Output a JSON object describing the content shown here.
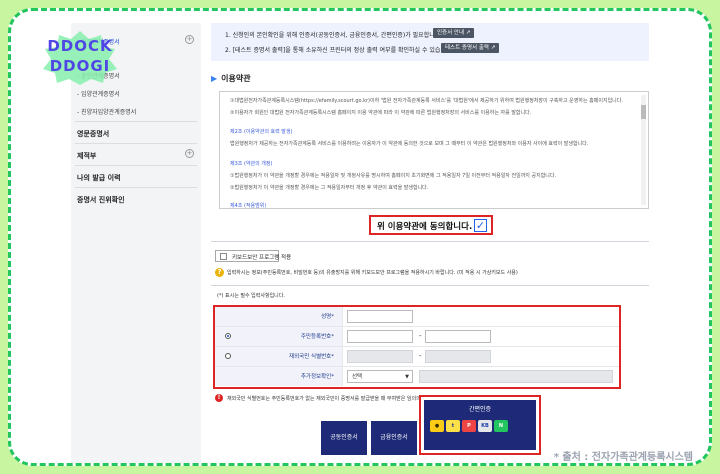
{
  "sidebar": {
    "top_item": "- 가족관계증명서",
    "items": [
      "- 혼인관계증명서",
      "- 입양관계증명서",
      "- 친양자입양관계증명서"
    ],
    "sections": [
      "영문증명서",
      "제적부",
      "나의 발급 이력",
      "증명서 진위확인"
    ]
  },
  "stamp": {
    "line1": "DDOCK",
    "line2": "DDOGI"
  },
  "notice": {
    "line1": "1. 신청인의 본인확인을 위해 인증서(공동인증서, 금융인증서, 간편인증)가 필요합니다.",
    "line1_btn": "인증서 안내 ↗",
    "line2": "2. [테스트 증명서 출력]을 통해 소유하신 프린터의 정상 출력 여부를 확인하실 수 있습니다.",
    "line2_btn": "테스트 증명서 출력 ↗"
  },
  "terms": {
    "title": "이용약관",
    "lines": [
      "①대법원전자가족관계등록시스템(https://efamily.scourt.go.kr)이하 '법원 전자가족관계등록 서비스'를 '대법원'에서 제공하기 위하여 법원행정처장이 구축하고 운영하는 홈페이지입니다.",
      "②이용자가 회원인 대법원 전자가족관계등록시스템 홈페이지 이용 약관에 따라 이 약관에 따른 법원행정처장의 서비스를 이용하는 자를 말합니다."
    ],
    "h2": "제2조 (이용약관의 효력 발생)",
    "p2": "법원행정처가 제공하는 전자가족관계등록 서비스를 이용하려는 이용자가 이 약관에 동의한 것으로 보며 그 때부터 이 약관은 법원행정처와 이용자 사이에 효력이 발생합니다.",
    "h3": "제3조 (약관의 개정)",
    "p3a": "①법원행정처가 이 약관을 개정할 경우에는 적용일자 및 개정사유를 명시하여 홈페이지 초기화면에 그 적용일자 7일 이전부터 적용일자 전일까지 공지합니다.",
    "p3b": "②법원행정처가 이 약관을 개정할 경우에는 그 적용일자부터 개정 후 약관이 효력을 발생합니다.",
    "h4": "제4조 (적용범위)"
  },
  "agree": {
    "label": "위 이용약관에 동의합니다.",
    "checked": true
  },
  "keyboard": {
    "label": "키보드보안 프로그램 적용"
  },
  "info_text": "입력하시는 정보(주민등록번호, 비밀번호 등)의 유출방지를 위해 키보드보안 프로그램을 적용하시기 바랍니다. (미 적용 시 가상키보드 사용)",
  "required_note": "(*) 표시는 필수 입력사항입니다.",
  "form": {
    "name_label": "성명*",
    "rrn_label": "주민등록번호*",
    "foreign_label": "재외국민 식별번호*",
    "extra_label": "추가정보확인*",
    "select_value": "선택"
  },
  "warning": "재외국민 식별번호는 주민등록번호가 없는 재외국민이 증명서를 발급받을 때 부여받은 임의의 식별번호입니다.",
  "buttons": {
    "joint": "공동인증서",
    "financial": "금융인증서",
    "simple": "간편인증",
    "logos": [
      "kakao",
      "toss",
      "PASS",
      "KB",
      "N"
    ]
  },
  "source": "* 출처 : 전자가족관계등록시스템"
}
